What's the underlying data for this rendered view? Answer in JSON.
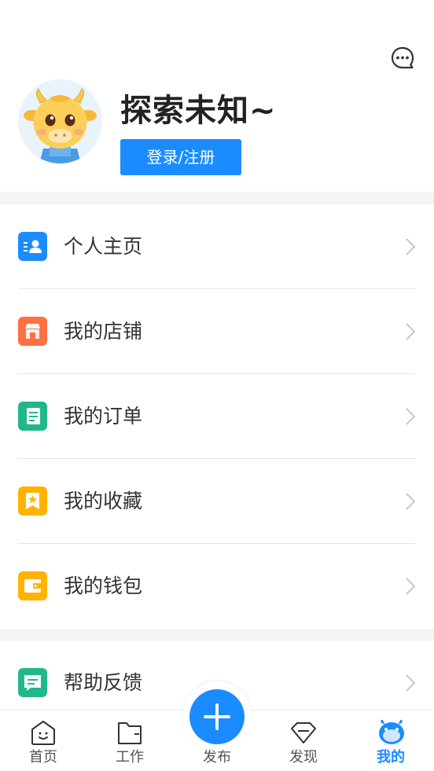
{
  "header": {
    "nickname": "探索未知~",
    "login_label": "登录/注册",
    "message_icon": "chat-bubble-icon",
    "avatar_icon": "cow-mascot-avatar"
  },
  "menu": {
    "items": [
      {
        "label": "个人主页",
        "icon": "profile-card-icon",
        "color": "#1a8cff"
      },
      {
        "label": "我的店铺",
        "icon": "shop-icon",
        "color": "#ff7043"
      },
      {
        "label": "我的订单",
        "icon": "order-list-icon",
        "color": "#21b78c"
      },
      {
        "label": "我的收藏",
        "icon": "star-bookmark-icon",
        "color": "#ffb300"
      },
      {
        "label": "我的钱包",
        "icon": "wallet-icon",
        "color": "#ffb300"
      },
      {
        "label": "帮助反馈",
        "icon": "feedback-bubble-icon",
        "color": "#21b78c"
      }
    ]
  },
  "tabbar": {
    "tabs": [
      {
        "label": "首页",
        "icon": "home-icon"
      },
      {
        "label": "工作",
        "icon": "folder-icon"
      },
      {
        "label": "发布",
        "icon": "plus-icon"
      },
      {
        "label": "发现",
        "icon": "diamond-icon"
      },
      {
        "label": "我的",
        "icon": "cow-face-icon"
      }
    ],
    "active_index": 4
  },
  "colors": {
    "accent": "#1a8cff",
    "divider": "#e6e6e6",
    "section_bg": "#f4f4f4"
  }
}
